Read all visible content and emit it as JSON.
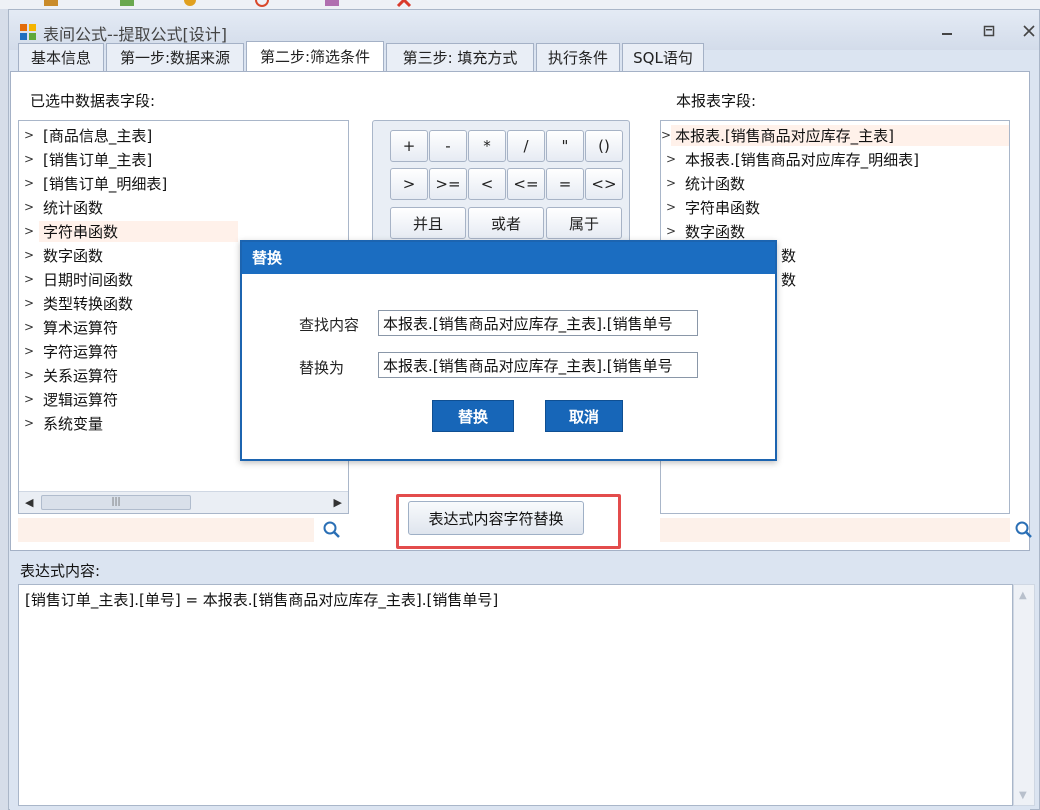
{
  "window": {
    "title": "表间公式--提取公式[设计]"
  },
  "tabs": [
    {
      "label": "基本信息",
      "active": false
    },
    {
      "label": "第一步:数据来源",
      "active": false
    },
    {
      "label": "第二步:筛选条件",
      "active": true
    },
    {
      "label": "第三步: 填充方式",
      "active": false
    },
    {
      "label": "执行条件",
      "active": false
    },
    {
      "label": "SQL语句",
      "active": false
    }
  ],
  "left_panel": {
    "label": "已选中数据表字段:",
    "items": [
      "[商品信息_主表]",
      "[销售订单_主表]",
      "[销售订单_明细表]",
      "统计函数",
      "字符串函数",
      "数字函数",
      "日期时间函数",
      "类型转换函数",
      "算术运算符",
      "字符运算符",
      "关系运算符",
      "逻辑运算符",
      "系统变量"
    ],
    "highlighted_index": 4,
    "search_value": ""
  },
  "operators": {
    "row1": [
      "+",
      "-",
      "*",
      "/",
      "\"",
      "()"
    ],
    "row2": [
      ">",
      ">=",
      "<",
      "<=",
      "=",
      "<>"
    ],
    "row3": [
      "并且",
      "或者",
      "属于"
    ]
  },
  "right_panel": {
    "label": "本报表字段:",
    "items": [
      "本报表.[销售商品对应库存_主表]",
      "本报表.[销售商品对应库存_明细表]",
      "统计函数",
      "字符串函数",
      "数字函数",
      "数",
      "数"
    ],
    "highlighted_index": 0,
    "search_value": ""
  },
  "replace_trigger_label": "表达式内容字符替换",
  "expression": {
    "label": "表达式内容:",
    "value": "[销售订单_主表].[单号] = 本报表.[销售商品对应库存_主表].[销售单号]"
  },
  "dialog": {
    "title": "替换",
    "find_label": "查找内容",
    "find_value": "本报表.[销售商品对应库存_主表].[销售单号",
    "replace_label": "替换为",
    "replace_value": "本报表.[销售商品对应库存_主表].[销售单号",
    "ok_label": "替换",
    "cancel_label": "取消"
  },
  "colors": {
    "dialog_accent": "#1b6dc1",
    "highlight": "#fff1ea",
    "callout": "#e34c4c"
  }
}
